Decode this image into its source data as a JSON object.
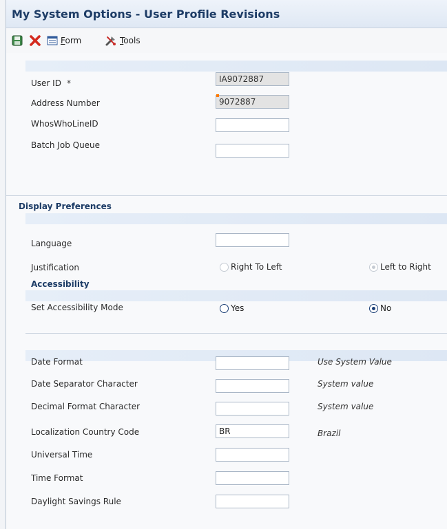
{
  "window": {
    "title": "My System Options - User Profile Revisions"
  },
  "toolbar": {
    "save_icon": "save-icon",
    "cancel_icon": "cancel-icon",
    "form_icon": "form-icon",
    "tools_icon": "tools-icon",
    "form_label": "Form",
    "tools_label": "Tools"
  },
  "user_section": {
    "user_id_label": "User ID",
    "required_marker": "*",
    "user_id_value": "IA9072887",
    "address_number_label": "Address Number",
    "address_number_value": "9072887",
    "whoswho_label": "WhosWhoLineID",
    "whoswho_value": "",
    "batch_queue_label": "Batch Job Queue",
    "batch_queue_value": ""
  },
  "display_prefs": {
    "title": "Display Preferences",
    "language_label": "Language",
    "language_value": "",
    "justification_label": "Justification",
    "right_to_left_label": "Right To Left",
    "left_to_right_label": "Left to Right",
    "justification_selected": "Left to Right"
  },
  "accessibility": {
    "title": "Accessibility",
    "mode_label": "Set Accessibility Mode",
    "yes_label": "Yes",
    "no_label": "No",
    "selected": "No"
  },
  "formats": {
    "date_format_label": "Date Format",
    "date_format_value": "",
    "date_format_hint": "Use System Value",
    "date_sep_label": "Date Separator Character",
    "date_sep_value": "",
    "date_sep_hint": "System value",
    "decimal_label": "Decimal Format Character",
    "decimal_value": "",
    "decimal_hint": "System value",
    "country_label": "Localization Country Code",
    "country_value": "BR",
    "country_hint": "Brazil",
    "universal_time_label": "Universal Time",
    "universal_time_value": "",
    "time_format_label": "Time Format",
    "time_format_value": "",
    "dst_label": "Daylight Savings Rule",
    "dst_value": ""
  },
  "colors": {
    "title_text": "#1d3c66",
    "band": "#dde7f4",
    "field_border": "#a9b6c6",
    "readonly_field": "#e3e3e3",
    "cancel_red": "#d42a1e",
    "save_green": "#3f8a4a"
  }
}
